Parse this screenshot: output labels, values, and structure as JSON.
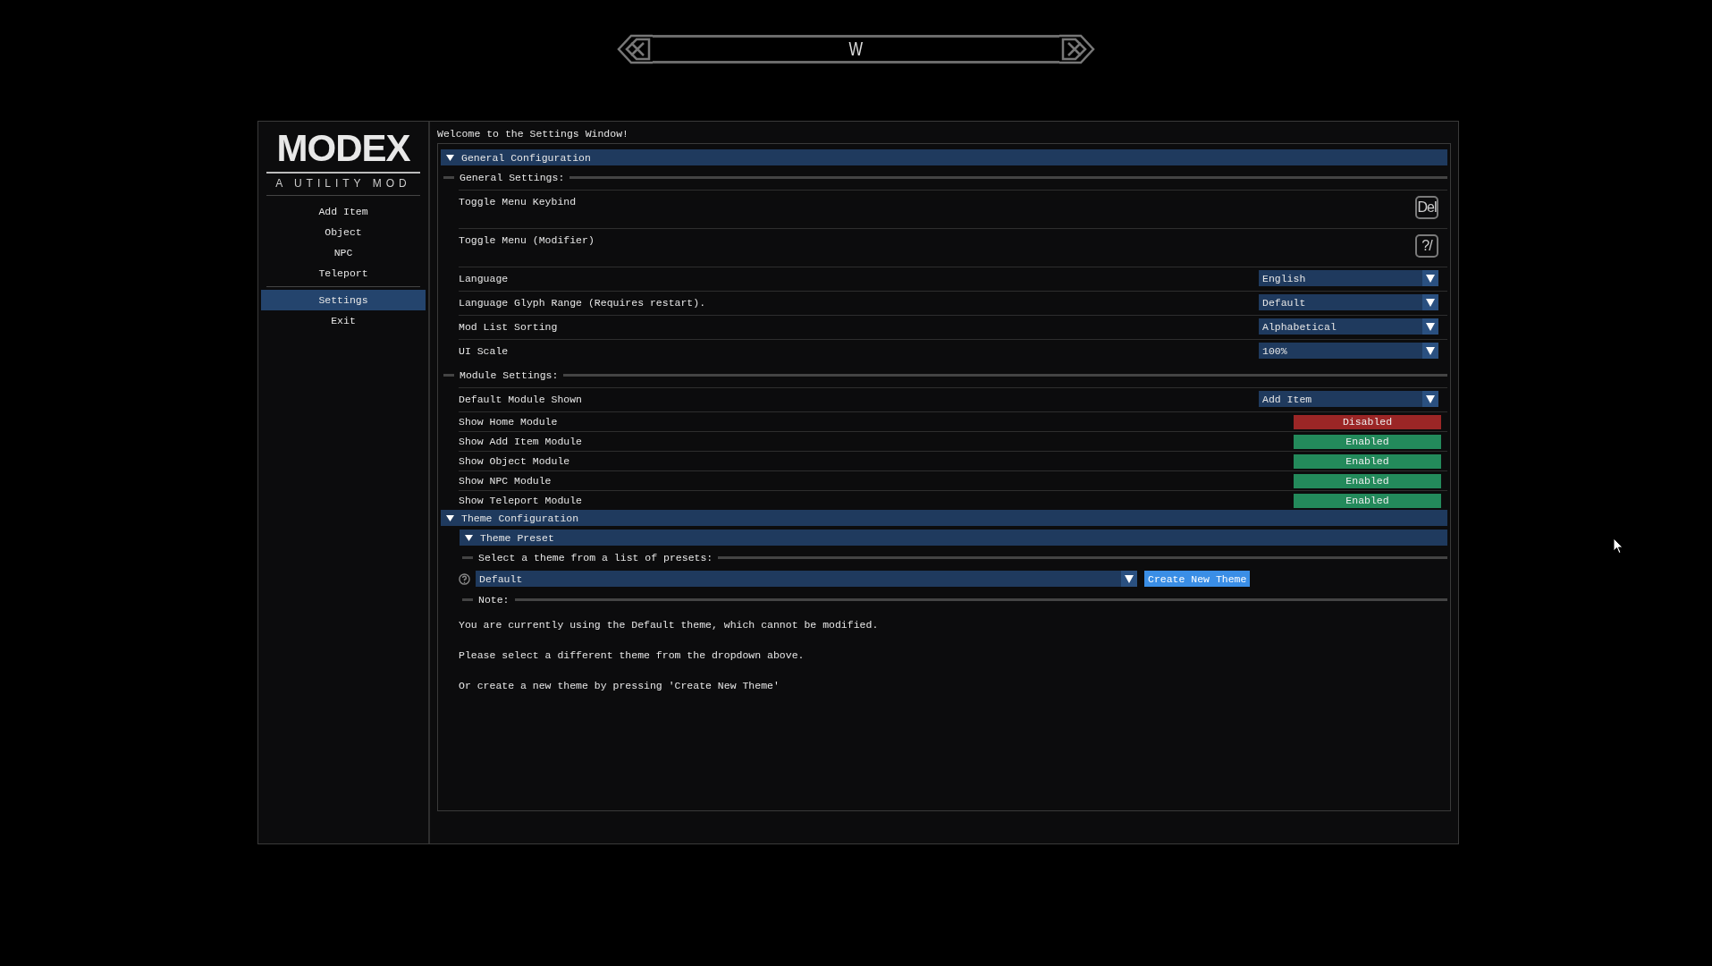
{
  "compass": {
    "heading": "W"
  },
  "sidebar": {
    "logo": "MODEX",
    "subtitle": "A UTILITY MOD",
    "items": [
      {
        "label": "Add Item",
        "selected": false
      },
      {
        "label": "Object",
        "selected": false
      },
      {
        "label": "NPC",
        "selected": false
      },
      {
        "label": "Teleport",
        "selected": false
      },
      {
        "label": "Settings",
        "selected": true
      },
      {
        "label": "Exit",
        "selected": false
      }
    ]
  },
  "welcome": "Welcome to the Settings Window!",
  "general": {
    "title": "General Configuration",
    "expanded": true,
    "groups": [
      {
        "title": "General Settings:",
        "rows": [
          {
            "kind": "key",
            "label": "Toggle Menu Keybind",
            "value": "Del"
          },
          {
            "kind": "key",
            "label": "Toggle Menu (Modifier)",
            "value": "?/"
          },
          {
            "kind": "dropdown",
            "label": "Language",
            "value": "English"
          },
          {
            "kind": "dropdown",
            "label": "Language Glyph Range (Requires restart).",
            "value": "Default"
          },
          {
            "kind": "dropdown",
            "label": "Mod List Sorting",
            "value": "Alphabetical"
          },
          {
            "kind": "dropdown",
            "label": "UI Scale",
            "value": "100%"
          }
        ]
      },
      {
        "title": "Module Settings:",
        "rows": [
          {
            "kind": "dropdown",
            "label": "Default Module Shown",
            "value": "Add Item"
          },
          {
            "kind": "toggle",
            "label": "Show Home Module",
            "on": false,
            "value": "Disabled"
          },
          {
            "kind": "toggle",
            "label": "Show Add Item Module",
            "on": true,
            "value": "Enabled"
          },
          {
            "kind": "toggle",
            "label": "Show Object Module",
            "on": true,
            "value": "Enabled"
          },
          {
            "kind": "toggle",
            "label": "Show NPC Module",
            "on": true,
            "value": "Enabled"
          },
          {
            "kind": "toggle",
            "label": "Show Teleport Module",
            "on": true,
            "value": "Enabled"
          }
        ]
      }
    ]
  },
  "theme": {
    "title": "Theme Configuration",
    "expanded": true,
    "preset": {
      "title": "Theme Preset",
      "expanded": true,
      "select_label": "Select a theme from a list of presets:",
      "dropdown": "Default",
      "button": "Create New Theme",
      "note_label": "Note:",
      "notes": [
        "You are currently using the Default theme, which cannot be modified.",
        "Please select a different theme from the dropdown above.",
        "Or create a new theme by pressing 'Create New Theme'"
      ]
    }
  }
}
